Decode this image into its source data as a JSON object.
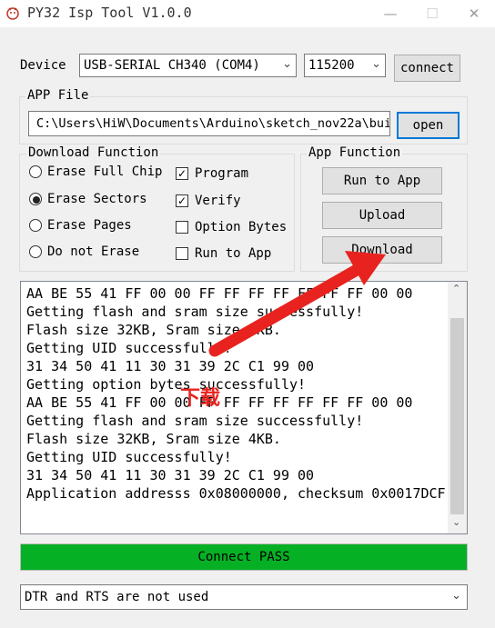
{
  "window": {
    "title": "PY32 Isp Tool V1.0.0",
    "minimize_glyph": "—",
    "maximize_glyph": "☐",
    "close_glyph": "✕"
  },
  "device": {
    "label": "Device",
    "port": "USB-SERIAL CH340 (COM4)",
    "baud": "115200",
    "connect_label": "connect"
  },
  "app_file": {
    "legend": "APP File",
    "path": "C:\\Users\\HiW\\Documents\\Arduino\\sketch_nov22a\\buil",
    "open_label": "open"
  },
  "download_function": {
    "legend": "Download Function",
    "radios": [
      {
        "label": "Erase Full Chip",
        "selected": false
      },
      {
        "label": "Erase Sectors",
        "selected": true
      },
      {
        "label": "Erase Pages",
        "selected": false
      },
      {
        "label": "Do not Erase",
        "selected": false
      }
    ],
    "checks": [
      {
        "label": "Program",
        "checked": true
      },
      {
        "label": "Verify",
        "checked": true
      },
      {
        "label": "Option Bytes",
        "checked": false
      },
      {
        "label": "Run to App",
        "checked": false
      }
    ]
  },
  "app_function": {
    "legend": "App Function",
    "run_label": "Run to App",
    "upload_label": "Upload",
    "download_label": "Download"
  },
  "annotation": {
    "text": "下载",
    "color": "#e8231f"
  },
  "log": {
    "lines": [
      "AA BE 55 41 FF 00 00 FF FF FF FF FF FF FF 00 00",
      "Getting flash and sram size successfully!",
      "Flash size 32KB, Sram size 4KB.",
      "Getting UID successfully!",
      "31 34 50 41 11 30 31 39 2C C1 99 00",
      "Getting option bytes successfully!",
      "AA BE 55 41 FF 00 00 FF FF FF FF FF FF FF 00 00",
      "Getting flash and sram size successfully!",
      "Flash size 32KB, Sram size 4KB.",
      "Getting UID successfully!",
      "31 34 50 41 11 30 31 39 2C C1 99 00",
      "Application addresss 0x08000000, checksum 0x0017DCF"
    ]
  },
  "status": {
    "text": "Connect PASS",
    "color": "#06b025"
  },
  "footer": {
    "mode": "DTR and RTS are not used"
  }
}
